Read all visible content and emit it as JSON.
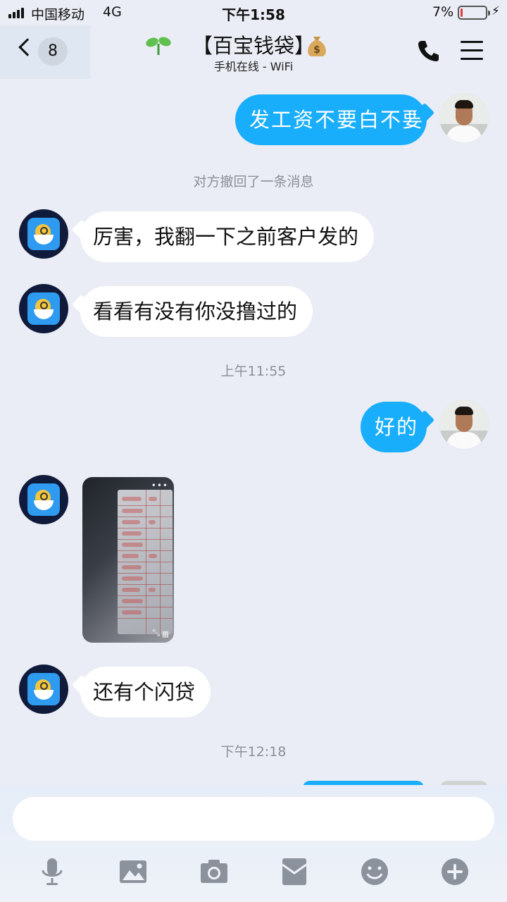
{
  "status_bar": {
    "carrier": "中国移动",
    "network": "4G",
    "time": "下午1:58",
    "battery_percent": "7%",
    "battery_level": 0.07
  },
  "header": {
    "back_count": "8",
    "title": "【百宝钱袋】",
    "title_prefix_icon": "sprout-icon",
    "title_suffix_icon": "money-bag-icon",
    "subtitle": "手机在线 - WiFi",
    "actions": [
      "phone-icon",
      "menu-icon"
    ]
  },
  "messages": {
    "m1": "发工资不要白不要",
    "recall_notice": "对方撤回了一条消息",
    "m2": "厉害，我翻一下之前客户发的",
    "m3": "看看有没有你没撸过的",
    "time1": "上午11:55",
    "m4": "好的",
    "m5_image_alt": "photo-of-lender-list",
    "m6": "还有个闪贷",
    "time2": "下午12:18"
  },
  "input": {
    "placeholder": "",
    "value": ""
  },
  "toolbar": {
    "icons": [
      "microphone-icon",
      "image-icon",
      "camera-icon",
      "red-packet-icon",
      "emoji-icon",
      "plus-icon"
    ]
  },
  "colors": {
    "outgoing_bubble": "#19aefc",
    "incoming_bubble": "#ffffff",
    "background": "#eaedf5",
    "system_text": "#8b8f98"
  }
}
